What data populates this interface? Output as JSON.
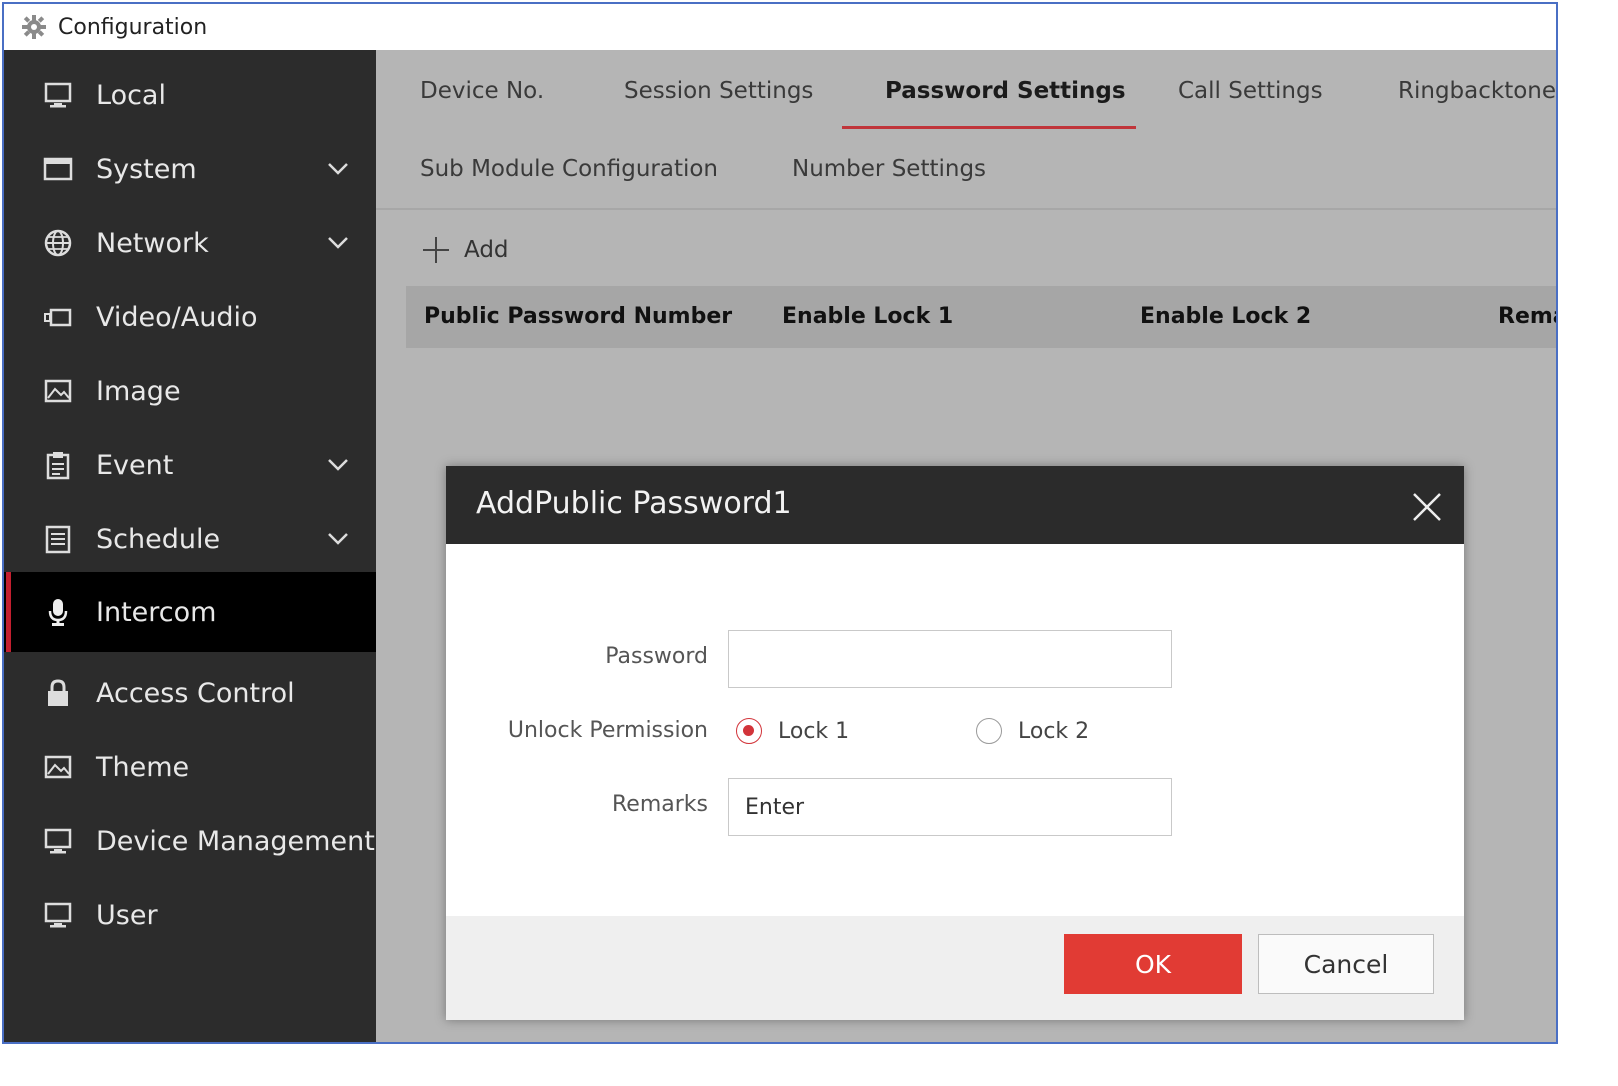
{
  "window": {
    "title": "Configuration"
  },
  "sidebar": {
    "items": [
      {
        "label": "Local",
        "icon": "monitor-icon",
        "expandable": false
      },
      {
        "label": "System",
        "icon": "window-icon",
        "expandable": true
      },
      {
        "label": "Network",
        "icon": "globe-icon",
        "expandable": true
      },
      {
        "label": "Video/Audio",
        "icon": "camera-icon",
        "expandable": false
      },
      {
        "label": "Image",
        "icon": "image-icon",
        "expandable": false
      },
      {
        "label": "Event",
        "icon": "clipboard-icon",
        "expandable": true
      },
      {
        "label": "Schedule",
        "icon": "list-icon",
        "expandable": true
      },
      {
        "label": "Intercom",
        "icon": "microphone-icon",
        "expandable": false,
        "active": true
      },
      {
        "label": "Access Control",
        "icon": "lock-icon",
        "expandable": false
      },
      {
        "label": "Theme",
        "icon": "image-icon",
        "expandable": false
      },
      {
        "label": "Device Management",
        "icon": "monitor-icon",
        "expandable": false
      },
      {
        "label": "User",
        "icon": "monitor-icon",
        "expandable": false
      }
    ]
  },
  "tabs": {
    "row1": [
      "Device No.",
      "Session Settings",
      "Password Settings",
      "Call Settings",
      "Ringbacktone S"
    ],
    "row2": [
      "Sub Module Configuration",
      "Number Settings"
    ],
    "active": "Password Settings"
  },
  "toolbar": {
    "add_label": "Add"
  },
  "table": {
    "columns": [
      "Public Password Number",
      "Enable Lock 1",
      "Enable Lock 2",
      "Remarks"
    ]
  },
  "dialog": {
    "title": "AddPublic Password1",
    "password_label": "Password",
    "password_value": "",
    "unlock_label": "Unlock Permission",
    "lock1_label": "Lock 1",
    "lock2_label": "Lock 2",
    "selected_lock": "Lock 1",
    "remarks_label": "Remarks",
    "remarks_placeholder": "Enter",
    "ok_label": "OK",
    "cancel_label": "Cancel"
  },
  "colors": {
    "accent_red": "#e13b34",
    "sidebar_bg": "#2c2c2c",
    "active_indicator": "#c41f2f"
  }
}
